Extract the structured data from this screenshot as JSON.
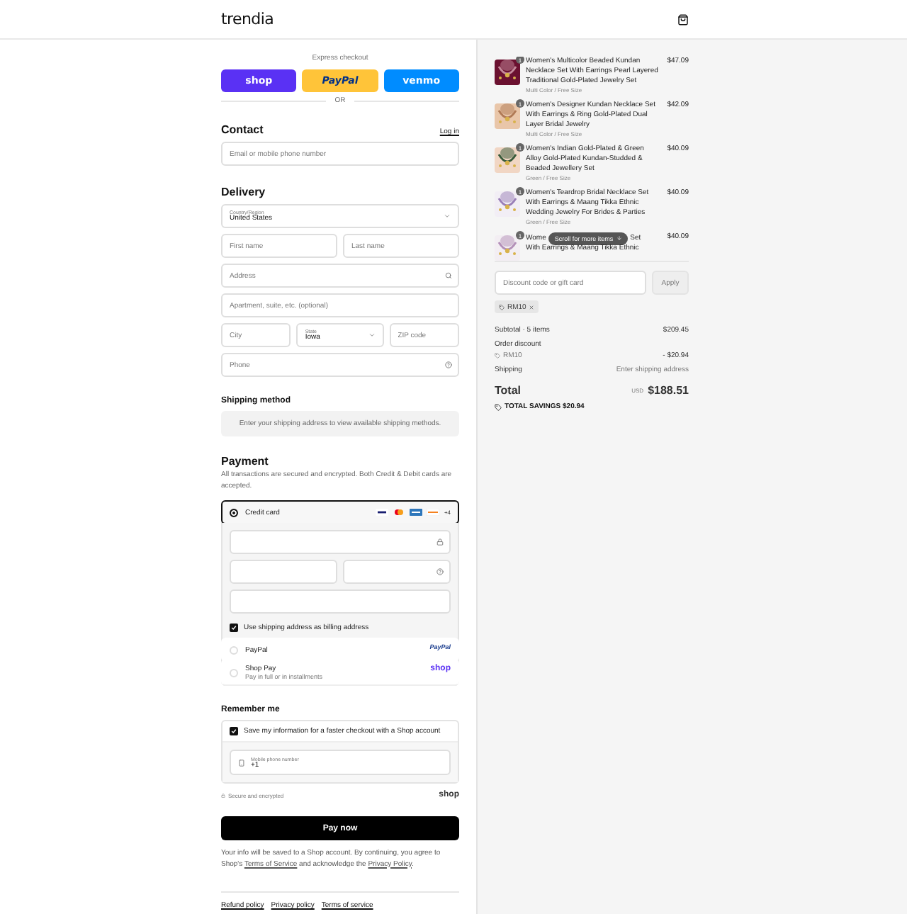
{
  "header": {
    "logo": "trendia"
  },
  "express_checkout": {
    "label": "Express checkout",
    "divider": "OR",
    "buttons": [
      {
        "kind": "shop",
        "label": "shop"
      },
      {
        "kind": "paypal",
        "label": "PayPal"
      },
      {
        "kind": "venmo",
        "label": "venmo"
      }
    ]
  },
  "contact": {
    "title": "Contact",
    "link": "Log in",
    "email": {
      "placeholder": "Email or mobile phone number"
    }
  },
  "delivery": {
    "title": "Delivery",
    "rows": [
      {
        "fields": [
          {
            "kind": "select",
            "label": "Country/Region",
            "value": "United States"
          }
        ]
      },
      {
        "fields": [
          {
            "kind": "text",
            "placeholder": "First name"
          },
          {
            "kind": "text",
            "placeholder": "Last name"
          }
        ]
      },
      {
        "fields": [
          {
            "kind": "search",
            "placeholder": "Address"
          }
        ]
      },
      {
        "fields": [
          {
            "kind": "text",
            "placeholder": "Apartment, suite, etc. (optional)"
          }
        ]
      },
      {
        "fields": [
          {
            "kind": "text",
            "placeholder": "City"
          },
          {
            "kind": "select",
            "label": "State",
            "value": "Iowa"
          },
          {
            "kind": "text",
            "placeholder": "ZIP code"
          }
        ]
      },
      {
        "fields": [
          {
            "kind": "help",
            "placeholder": "Phone"
          }
        ]
      }
    ]
  },
  "shipping_method": {
    "title": "Shipping method",
    "message": "Enter your shipping address to view available shipping methods."
  },
  "payment": {
    "title": "Payment",
    "description": "All transactions are secured and encrypted. Both Credit & Debit cards are accepted.",
    "methods": [
      {
        "kind": "card",
        "label": "Credit card",
        "selected": true,
        "more_cards": "+4"
      },
      {
        "kind": "paypal",
        "label": "PayPal",
        "selected": false,
        "badge": "PayPal"
      },
      {
        "kind": "shop_pay",
        "label": "Shop Pay",
        "sublabel": "Pay in full or in installments",
        "selected": false,
        "badge": "shop"
      }
    ],
    "card_rows": [
      {
        "fields": [
          {
            "kind": "lock"
          }
        ]
      },
      {
        "fields": [
          {
            "kind": "text"
          },
          {
            "kind": "help"
          }
        ]
      },
      {
        "fields": [
          {
            "kind": "text"
          }
        ]
      }
    ],
    "billing_same": {
      "label": "Use shipping address as billing address",
      "checked": true
    }
  },
  "remember_me": {
    "title": "Remember me",
    "save": {
      "label": "Save my information for a faster checkout with a Shop account",
      "checked": true
    },
    "phone": {
      "label": "Mobile phone number",
      "value": "+1"
    },
    "secure": "Secure and encrypted",
    "logo": "shop"
  },
  "pay_button": "Pay now",
  "legal": [
    {
      "text": "Your info will be saved to a Shop account. By continuing, you agree to Shop's ",
      "link": false
    },
    {
      "text": "Terms of Service",
      "link": true
    },
    {
      "text": " and acknowledge the ",
      "link": false
    },
    {
      "text": "Privacy Policy",
      "link": true
    },
    {
      "text": ".",
      "link": false
    }
  ],
  "footer_links": [
    "Refund policy",
    "Privacy policy",
    "Terms of service"
  ],
  "summary": {
    "items": [
      {
        "kind": "full",
        "quantity": "1",
        "title": "Women's Multicolor Beaded Kundan Necklace Set With Earrings Pearl Layered Traditional Gold-Plated Jewelry Set",
        "variant": "Multi Color / Free Size",
        "price": "$47.09"
      },
      {
        "kind": "full",
        "quantity": "1",
        "title": "Women's Designer Kundan Necklace Set With Earrings & Ring Gold-Plated Dual Layer Bridal Jewelry",
        "variant": "Multi Color / Free Size",
        "price": "$42.09"
      },
      {
        "kind": "full",
        "quantity": "1",
        "title": "Women's Indian Gold-Plated & Green Alloy Gold-Plated Kundan-Studded & Beaded Jewellery Set",
        "variant": "Green / Free Size",
        "price": "$40.09"
      },
      {
        "kind": "full",
        "quantity": "1",
        "title": "Women's Teardrop Bridal Necklace Set With Earrings & Maang Tikka Ethnic Wedding Jewelry For Brides & Parties",
        "variant": "Green / Free Size",
        "price": "$40.09"
      },
      {
        "kind": "covered",
        "quantity": "1",
        "title_start": "Wome",
        "scroll_hint": "Scroll for more items",
        "title_end": "Set",
        "title_line2": "With Earrings & Maang Tikka Ethnic",
        "price": "$40.09"
      }
    ],
    "discount": {
      "placeholder": "Discount code or gift card",
      "button": "Apply",
      "applied": "RM10"
    },
    "subtotal": {
      "label": "Subtotal · 5 items",
      "value": "$209.45"
    },
    "order_discount": {
      "label": "Order discount",
      "code": "RM10",
      "value": "- $20.94"
    },
    "shipping": {
      "label": "Shipping",
      "value": "Enter shipping address"
    },
    "total": {
      "label": "Total",
      "currency": "USD",
      "value": "$188.51"
    },
    "savings": {
      "label": "TOTAL SAVINGS",
      "value": "$20.94"
    }
  }
}
